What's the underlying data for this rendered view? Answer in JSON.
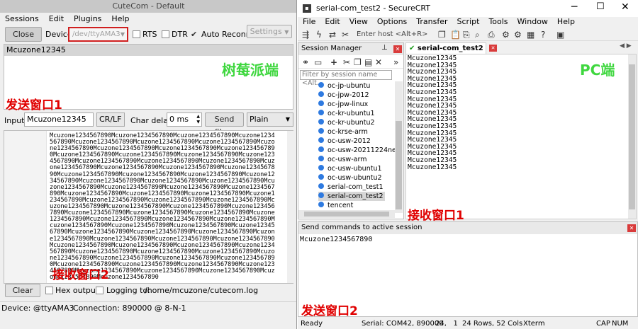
{
  "cutecom": {
    "title": "CuteCom - Default",
    "menu": [
      "Sessions",
      "Edit",
      "Plugins",
      "Help"
    ],
    "close_label": "Close",
    "device_label": "Device:",
    "device_value": "/dev/ttyAMA3",
    "rts_label": "RTS",
    "dtr_label": "DTR",
    "auto_reconnect_label": "Auto Reconnect",
    "settings_label": "Settings",
    "send_history": [
      "Mcuzone12345"
    ],
    "annotation_send": "发送窗口1",
    "annotation_pi": "树莓派端",
    "input_label": "Input:",
    "input_value": "Mcuzone12345",
    "line_ending": "CR/LF",
    "char_delay_label": "Char delay:",
    "char_delay_value": "0 ms",
    "send_file_label": "Send file...",
    "mode": "Plain",
    "received_text": "Mcuzone1234567890Mcuzone1234567890Mcuzone1234567890Mcuzone1234567890Mcuzone1234567890Mcuzone1234567890Mcuzone1234567890Mcuzone1234567890Mcuzone1234567890Mcuzone1234567890Mcuzone1234567890Mcuzone1234567890Mcuzone1234567890Mcuzone1234567890Mcuzone1234567890Mcuzone1234567890Mcuzone1234567890Mcuzone1234567890Mcuzone1234567890Mcuzone1234567890Mcuzone1234567890Mcuzone1234567890Mcuzone1234567890Mcuzone1234567890Mcuzone1234567890Mcuzone1234567890Mcuzone1234567890Mcuzone1234567890Mcuzone1234567890Mcuzone1234567890Mcuzone1234567890Mcuzone1234567890Mcuzone1234567890Mcuzone1234567890Mcuzone1234567890Mcuzone1234567890Mcuzone1234567890Mcuzone1234567890Mcuzone1234567890Mcuzone1234567890Mcuzone1234567890Mcuzone1234567890Mcuzone1234567890Mcuzone1234567890Mcuzone1234567890Mcuzone1234567890Mcuzone1234567890Mcuzone1234567890Mcuzone1234567890Mcuzone1234567890Mcuzone1234567890Mcuzone1234567890Mcuzone1234567890Mcuzone1234567890Mcuzone1234567890Mcuzone1234567890Mcuzone1234567890Mcuzone1234567890Mcuzone1234567890Mcuzone1234567890Mcuzone1234567890Mcuzone1234567890Mcuzone1234567890Mcuzone1234567890Mcuzone1234567890Mcuzone1234567890Mcuzone1234567890Mcuzone1234567890Mcuzone1234567890Mcuzone1234567890Mcuzone1234567890Mcuzone1234567890Mcuzone1234567890Mcuzone1234567890Mcuzone1234567890Mcuzone1234567890Mcuzone1234567890Mcuzone1234567890Mcuzone1234567890Mcuzone1234567890Mcuzone1234567890Mcuzone1234567890",
    "annotation_recv": "接收窗口2",
    "clear_label": "Clear",
    "hex_output_label": "Hex output",
    "logging_label": "Logging to:",
    "log_path": "/home/mcuzone/cutecom.log",
    "status_device": "Device:   @ttyAMA3",
    "status_connection": "Connection:  890000 @ 8-N-1"
  },
  "securecrt": {
    "title": "serial-com_test2 - SecureCRT",
    "menu": [
      "File",
      "Edit",
      "View",
      "Options",
      "Transfer",
      "Script",
      "Tools",
      "Window",
      "Help"
    ],
    "enter_host_placeholder": "Enter host <Alt+R>",
    "session_manager": {
      "title": "Session Manager",
      "filter_placeholder": "Filter by session name <Alt...",
      "sessions": [
        "oc-jp-ubuntu",
        "oc-jpw-2012",
        "oc-jpw-linux",
        "oc-kr-ubuntu1",
        "oc-kr-ubuntu2",
        "oc-krse-arm",
        "oc-usw-2012",
        "oc-usw-20211224ne",
        "oc-usw-arm",
        "oc-usw-ubuntu1",
        "oc-usw-ubuntu2",
        "serial-com_test1",
        "serial-com_test2",
        "tencent"
      ],
      "selected": "serial-com_test2"
    },
    "tab_label": "serial-com_test2",
    "terminal_lines": [
      "Mcuzone12345",
      "Mcuzone12345",
      "Mcuzone12345",
      "Mcuzone12345",
      "Mcuzone12345",
      "Mcuzone12345",
      "Mcuzone12345",
      "Mcuzone12345",
      "Mcuzone12345",
      "Mcuzone12345",
      "Mcuzone12345",
      "Mcuzone12345",
      "Mcuzone12345",
      "Mcuzone12345",
      "Mcuzone12345",
      "Mcuzone12345",
      "Mcuzone12345"
    ],
    "annotation_pc": "PC端",
    "annotation_recv": "接收窗口1",
    "command_window_title": "Send commands to active session",
    "command_text": "Mcuzone1234567890",
    "annotation_send": "发送窗口2",
    "status": {
      "ready": "Ready",
      "serial": "Serial: COM42, 890000",
      "position": "24,   1",
      "size": "24 Rows, 52 Cols",
      "term": "Xterm",
      "cap": "CAP",
      "num": "NUM"
    }
  },
  "colors": {
    "annotation_red": "#e00000",
    "annotation_green": "#3fd73f",
    "device_highlight": "#d01f1f",
    "close_x_red": "#d93b3b"
  }
}
